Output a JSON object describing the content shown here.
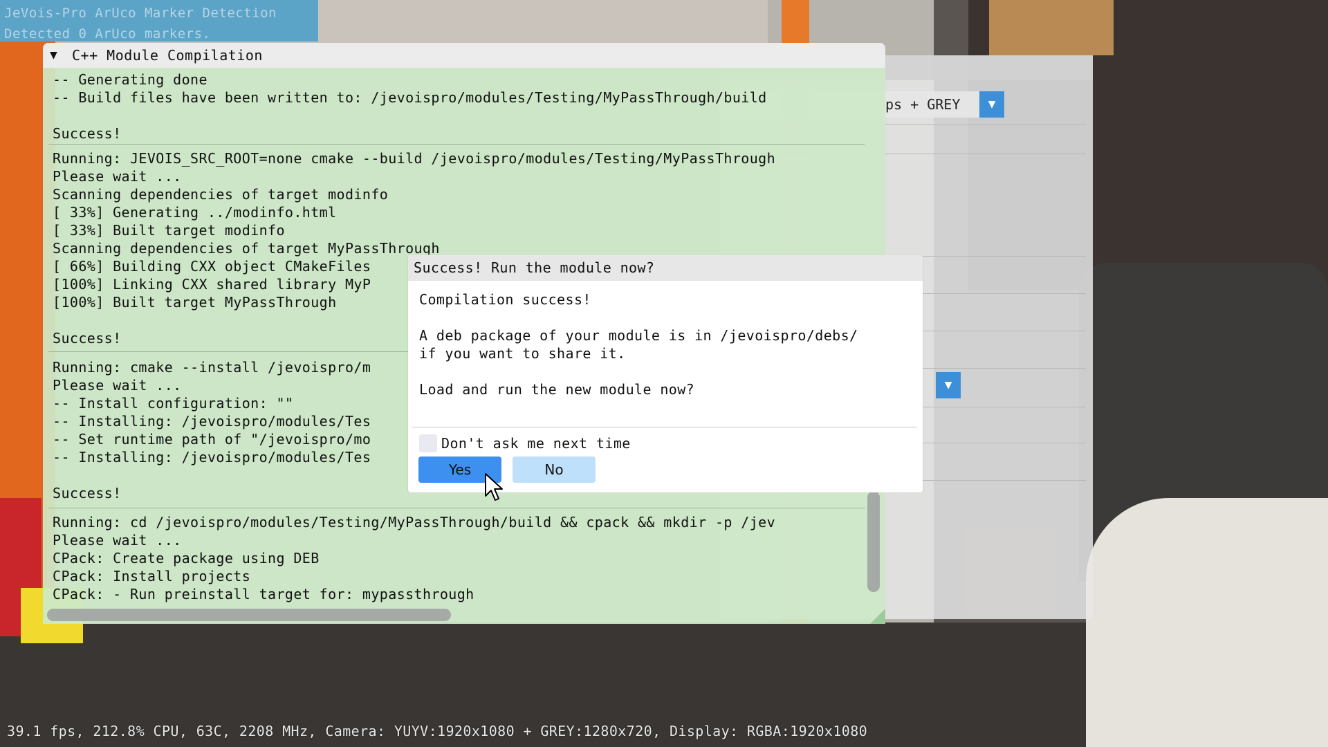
{
  "overlay": {
    "title": "JeVois-Pro ArUco Marker Detection",
    "detections": "Detected 0 ArUco markers."
  },
  "config_window": {
    "combo_value": "ps + GREY"
  },
  "compile_window": {
    "title": "C++ Module Compilation",
    "log_block1": [
      "-- Generating done",
      "-- Build files have been written to: /jevoispro/modules/Testing/MyPassThrough/build",
      "",
      "Success!"
    ],
    "log_block2": [
      "Running: JEVOIS_SRC_ROOT=none cmake --build /jevoispro/modules/Testing/MyPassThrough",
      "Please wait ...",
      "Scanning dependencies of target modinfo",
      "[ 33%] Generating ../modinfo.html",
      "[ 33%] Built target modinfo",
      "Scanning dependencies of target MyPassThrough",
      "[ 66%] Building CXX object CMakeFiles",
      "[100%] Linking CXX shared library MyP",
      "[100%] Built target MyPassThrough",
      "",
      "Success!"
    ],
    "log_block3": [
      "Running: cmake --install /jevoispro/m",
      "Please wait ...",
      "-- Install configuration: \"\"",
      "-- Installing: /jevoispro/modules/Tes",
      "-- Set runtime path of \"/jevoispro/mo",
      "-- Installing: /jevoispro/modules/Tes",
      "",
      "Success!"
    ],
    "log_block4": [
      "Running: cd /jevoispro/modules/Testing/MyPassThrough/build && cpack && mkdir -p /jev",
      "Please wait ...",
      "CPack: Create package using DEB",
      "CPack: Install projects",
      "CPack: - Run preinstall target for: mypassthrough"
    ]
  },
  "modal": {
    "title": "Success! Run the module now?",
    "line1": "Compilation success!",
    "line2": "A deb package of your module is in /jevoispro/debs/",
    "line3": "if you want to share it.",
    "line4": "Load and run the new module now?",
    "checkbox_label": "Don't ask me next time",
    "checkbox_checked": false,
    "yes_label": "Yes",
    "no_label": "No"
  },
  "status_bar": {
    "text": "39.1 fps, 212.8% CPU, 63C, 2208 MHz, Camera: YUYV:1920x1080 + GREY:1280x720, Display: RGBA:1920x1080"
  },
  "colors": {
    "accent_button": "#3d8ff0",
    "secondary_button": "#bfe0fb",
    "compile_bg": "#cde8c8",
    "status_text": "#e8e8e8"
  },
  "icons": {
    "collapse": "triangle-down-icon",
    "combo": "chevron-down-icon",
    "cursor": "mouse-pointer-icon"
  }
}
